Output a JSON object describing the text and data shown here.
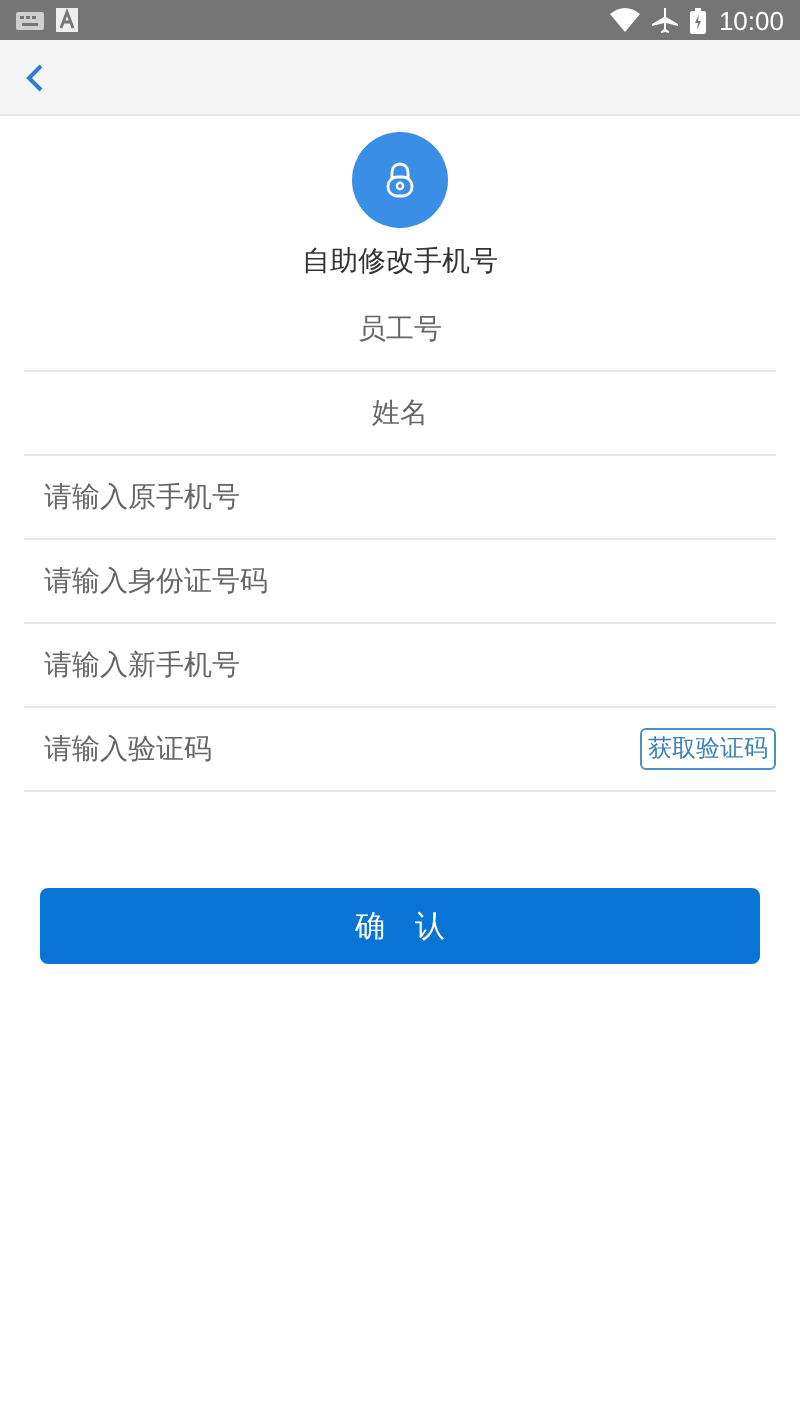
{
  "status_bar": {
    "time": "10:00"
  },
  "header": {
    "title": "自助修改手机号"
  },
  "fields": [
    {
      "kind": "info",
      "placeholder": "员工号"
    },
    {
      "kind": "info",
      "placeholder": "姓名"
    },
    {
      "kind": "input",
      "placeholder": "请输入原手机号"
    },
    {
      "kind": "input",
      "placeholder": "请输入身份证号码"
    },
    {
      "kind": "input",
      "placeholder": "请输入新手机号"
    },
    {
      "kind": "code",
      "placeholder": "请输入验证码",
      "button": "获取验证码"
    }
  ],
  "confirm_button": "确　认"
}
